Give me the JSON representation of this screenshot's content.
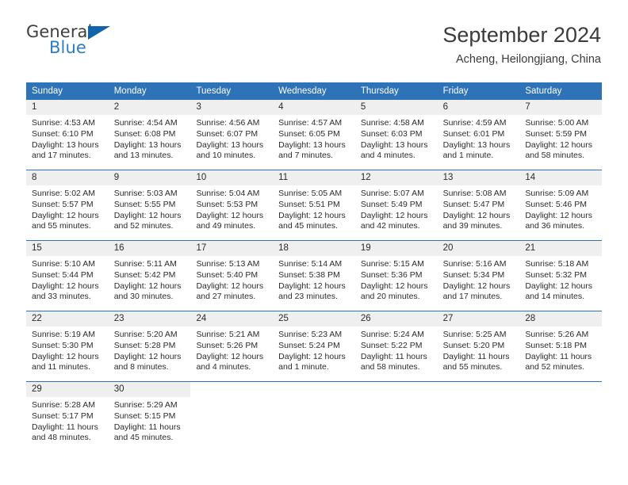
{
  "brand": {
    "name_top": "General",
    "name_bottom": "Blue",
    "triangle_icon": "blue-triangle-logo-icon",
    "color_dark": "#3f3f3f",
    "color_blue": "#2e7cc4",
    "triangle_color": "#1163ab"
  },
  "header": {
    "title": "September 2024",
    "subtitle": "Acheng, Heilongjiang, China"
  },
  "theme": {
    "header_blue": "#2e72b8",
    "day_band_gray": "#efefef",
    "text": "#2b2b2b"
  },
  "weekdays": [
    "Sunday",
    "Monday",
    "Tuesday",
    "Wednesday",
    "Thursday",
    "Friday",
    "Saturday"
  ],
  "weeks": [
    [
      {
        "day": "1",
        "sunrise": "Sunrise: 4:53 AM",
        "sunset": "Sunset: 6:10 PM",
        "daylight_1": "Daylight: 13 hours",
        "daylight_2": "and 17 minutes."
      },
      {
        "day": "2",
        "sunrise": "Sunrise: 4:54 AM",
        "sunset": "Sunset: 6:08 PM",
        "daylight_1": "Daylight: 13 hours",
        "daylight_2": "and 13 minutes."
      },
      {
        "day": "3",
        "sunrise": "Sunrise: 4:56 AM",
        "sunset": "Sunset: 6:07 PM",
        "daylight_1": "Daylight: 13 hours",
        "daylight_2": "and 10 minutes."
      },
      {
        "day": "4",
        "sunrise": "Sunrise: 4:57 AM",
        "sunset": "Sunset: 6:05 PM",
        "daylight_1": "Daylight: 13 hours",
        "daylight_2": "and 7 minutes."
      },
      {
        "day": "5",
        "sunrise": "Sunrise: 4:58 AM",
        "sunset": "Sunset: 6:03 PM",
        "daylight_1": "Daylight: 13 hours",
        "daylight_2": "and 4 minutes."
      },
      {
        "day": "6",
        "sunrise": "Sunrise: 4:59 AM",
        "sunset": "Sunset: 6:01 PM",
        "daylight_1": "Daylight: 13 hours",
        "daylight_2": "and 1 minute."
      },
      {
        "day": "7",
        "sunrise": "Sunrise: 5:00 AM",
        "sunset": "Sunset: 5:59 PM",
        "daylight_1": "Daylight: 12 hours",
        "daylight_2": "and 58 minutes."
      }
    ],
    [
      {
        "day": "8",
        "sunrise": "Sunrise: 5:02 AM",
        "sunset": "Sunset: 5:57 PM",
        "daylight_1": "Daylight: 12 hours",
        "daylight_2": "and 55 minutes."
      },
      {
        "day": "9",
        "sunrise": "Sunrise: 5:03 AM",
        "sunset": "Sunset: 5:55 PM",
        "daylight_1": "Daylight: 12 hours",
        "daylight_2": "and 52 minutes."
      },
      {
        "day": "10",
        "sunrise": "Sunrise: 5:04 AM",
        "sunset": "Sunset: 5:53 PM",
        "daylight_1": "Daylight: 12 hours",
        "daylight_2": "and 49 minutes."
      },
      {
        "day": "11",
        "sunrise": "Sunrise: 5:05 AM",
        "sunset": "Sunset: 5:51 PM",
        "daylight_1": "Daylight: 12 hours",
        "daylight_2": "and 45 minutes."
      },
      {
        "day": "12",
        "sunrise": "Sunrise: 5:07 AM",
        "sunset": "Sunset: 5:49 PM",
        "daylight_1": "Daylight: 12 hours",
        "daylight_2": "and 42 minutes."
      },
      {
        "day": "13",
        "sunrise": "Sunrise: 5:08 AM",
        "sunset": "Sunset: 5:47 PM",
        "daylight_1": "Daylight: 12 hours",
        "daylight_2": "and 39 minutes."
      },
      {
        "day": "14",
        "sunrise": "Sunrise: 5:09 AM",
        "sunset": "Sunset: 5:46 PM",
        "daylight_1": "Daylight: 12 hours",
        "daylight_2": "and 36 minutes."
      }
    ],
    [
      {
        "day": "15",
        "sunrise": "Sunrise: 5:10 AM",
        "sunset": "Sunset: 5:44 PM",
        "daylight_1": "Daylight: 12 hours",
        "daylight_2": "and 33 minutes."
      },
      {
        "day": "16",
        "sunrise": "Sunrise: 5:11 AM",
        "sunset": "Sunset: 5:42 PM",
        "daylight_1": "Daylight: 12 hours",
        "daylight_2": "and 30 minutes."
      },
      {
        "day": "17",
        "sunrise": "Sunrise: 5:13 AM",
        "sunset": "Sunset: 5:40 PM",
        "daylight_1": "Daylight: 12 hours",
        "daylight_2": "and 27 minutes."
      },
      {
        "day": "18",
        "sunrise": "Sunrise: 5:14 AM",
        "sunset": "Sunset: 5:38 PM",
        "daylight_1": "Daylight: 12 hours",
        "daylight_2": "and 23 minutes."
      },
      {
        "day": "19",
        "sunrise": "Sunrise: 5:15 AM",
        "sunset": "Sunset: 5:36 PM",
        "daylight_1": "Daylight: 12 hours",
        "daylight_2": "and 20 minutes."
      },
      {
        "day": "20",
        "sunrise": "Sunrise: 5:16 AM",
        "sunset": "Sunset: 5:34 PM",
        "daylight_1": "Daylight: 12 hours",
        "daylight_2": "and 17 minutes."
      },
      {
        "day": "21",
        "sunrise": "Sunrise: 5:18 AM",
        "sunset": "Sunset: 5:32 PM",
        "daylight_1": "Daylight: 12 hours",
        "daylight_2": "and 14 minutes."
      }
    ],
    [
      {
        "day": "22",
        "sunrise": "Sunrise: 5:19 AM",
        "sunset": "Sunset: 5:30 PM",
        "daylight_1": "Daylight: 12 hours",
        "daylight_2": "and 11 minutes."
      },
      {
        "day": "23",
        "sunrise": "Sunrise: 5:20 AM",
        "sunset": "Sunset: 5:28 PM",
        "daylight_1": "Daylight: 12 hours",
        "daylight_2": "and 8 minutes."
      },
      {
        "day": "24",
        "sunrise": "Sunrise: 5:21 AM",
        "sunset": "Sunset: 5:26 PM",
        "daylight_1": "Daylight: 12 hours",
        "daylight_2": "and 4 minutes."
      },
      {
        "day": "25",
        "sunrise": "Sunrise: 5:23 AM",
        "sunset": "Sunset: 5:24 PM",
        "daylight_1": "Daylight: 12 hours",
        "daylight_2": "and 1 minute."
      },
      {
        "day": "26",
        "sunrise": "Sunrise: 5:24 AM",
        "sunset": "Sunset: 5:22 PM",
        "daylight_1": "Daylight: 11 hours",
        "daylight_2": "and 58 minutes."
      },
      {
        "day": "27",
        "sunrise": "Sunrise: 5:25 AM",
        "sunset": "Sunset: 5:20 PM",
        "daylight_1": "Daylight: 11 hours",
        "daylight_2": "and 55 minutes."
      },
      {
        "day": "28",
        "sunrise": "Sunrise: 5:26 AM",
        "sunset": "Sunset: 5:18 PM",
        "daylight_1": "Daylight: 11 hours",
        "daylight_2": "and 52 minutes."
      }
    ],
    [
      {
        "day": "29",
        "sunrise": "Sunrise: 5:28 AM",
        "sunset": "Sunset: 5:17 PM",
        "daylight_1": "Daylight: 11 hours",
        "daylight_2": "and 48 minutes."
      },
      {
        "day": "30",
        "sunrise": "Sunrise: 5:29 AM",
        "sunset": "Sunset: 5:15 PM",
        "daylight_1": "Daylight: 11 hours",
        "daylight_2": "and 45 minutes."
      },
      {
        "day": "",
        "sunrise": "",
        "sunset": "",
        "daylight_1": "",
        "daylight_2": ""
      },
      {
        "day": "",
        "sunrise": "",
        "sunset": "",
        "daylight_1": "",
        "daylight_2": ""
      },
      {
        "day": "",
        "sunrise": "",
        "sunset": "",
        "daylight_1": "",
        "daylight_2": ""
      },
      {
        "day": "",
        "sunrise": "",
        "sunset": "",
        "daylight_1": "",
        "daylight_2": ""
      },
      {
        "day": "",
        "sunrise": "",
        "sunset": "",
        "daylight_1": "",
        "daylight_2": ""
      }
    ]
  ]
}
